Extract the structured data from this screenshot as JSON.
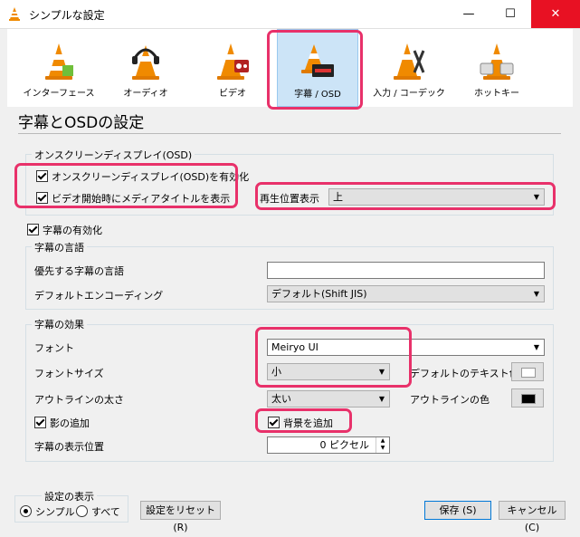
{
  "window": {
    "title": "シンプルな設定",
    "minimize_glyph": "—",
    "maximize_glyph": "☐",
    "close_glyph": "✕"
  },
  "categories": [
    {
      "label": "インターフェース",
      "icon": "interface-cone-icon"
    },
    {
      "label": "オーディオ",
      "icon": "audio-cone-icon"
    },
    {
      "label": "ビデオ",
      "icon": "video-cone-icon"
    },
    {
      "label": "字幕 / OSD",
      "icon": "subtitles-cone-icon",
      "selected": true
    },
    {
      "label": "入力 / コーデック",
      "icon": "input-codecs-cone-icon"
    },
    {
      "label": "ホットキー",
      "icon": "hotkeys-cone-icon"
    }
  ],
  "heading": "字幕とOSDの設定",
  "osd": {
    "group_title": "オンスクリーンディスプレイ(OSD)",
    "enable_osd": {
      "label": "オンスクリーンディスプレイ(OSD)を有効化",
      "checked": true
    },
    "show_title": {
      "label": "ビデオ開始時にメディアタイトルを表示",
      "checked": true
    },
    "position_label": "再生位置表示",
    "position_value": "上"
  },
  "subtitles_enable": {
    "label": "字幕の有効化",
    "checked": true
  },
  "language": {
    "group_title": "字幕の言語",
    "preferred_label": "優先する字幕の言語",
    "preferred_value": "",
    "encoding_label": "デフォルトエンコーディング",
    "encoding_value": "デフォルト(Shift JIS)"
  },
  "effects": {
    "group_title": "字幕の効果",
    "font_label": "フォント",
    "font_value": "Meiryo UI",
    "font_size_label": "フォントサイズ",
    "font_size_value": "小",
    "text_color_label": "デフォルトのテキスト色",
    "text_color": "#ffffff",
    "outline_thickness_label": "アウトラインの太さ",
    "outline_thickness_value": "太い",
    "outline_color_label": "アウトラインの色",
    "outline_color": "#000000",
    "shadow": {
      "label": "影の追加",
      "checked": true
    },
    "background": {
      "label": "背景を追加",
      "checked": true
    },
    "position_label": "字幕の表示位置",
    "position_value": "0 ピクセル"
  },
  "show_settings": {
    "group_title": "設定の表示",
    "simple_label": "シンプル",
    "all_label": "すべて",
    "selected": "simple"
  },
  "buttons": {
    "reset": "設定をリセット (R)",
    "save": "保存 (S)",
    "cancel": "キャンセル (C)"
  },
  "colors": {
    "highlight": "#e8316a",
    "selection": "#cce4f7",
    "close_red": "#e81123",
    "vlc_orange": "#f08a00"
  }
}
